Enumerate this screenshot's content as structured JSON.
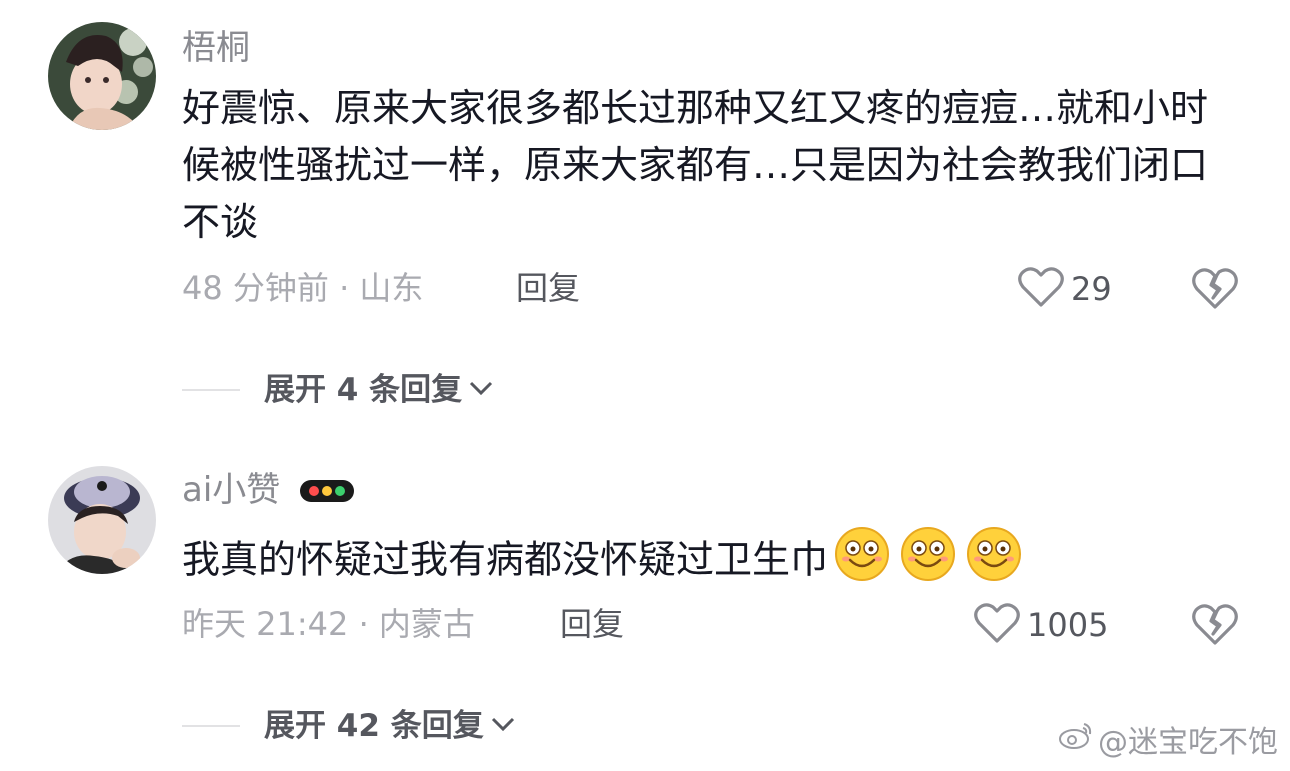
{
  "comments": [
    {
      "username": "梧桐",
      "text": "好震惊、原来大家很多都长过那种又红又疼的痘痘…就和小时候被性骚扰过一样，原来大家都有…只是因为社会教我们闭口不谈",
      "time_location": "48 分钟前 · 山东",
      "reply_label": "回复",
      "likes": "29",
      "expand_label": "展开 4 条回复"
    },
    {
      "username": "ai小赞",
      "text": "我真的怀疑过我有病都没怀疑过卫生巾",
      "emojis": [
        "smile-emoji",
        "smile-emoji",
        "smile-emoji"
      ],
      "time_location": "昨天 21:42 · 内蒙古",
      "reply_label": "回复",
      "likes": "1005",
      "expand_label": "展开 42 条回复"
    }
  ],
  "watermark": "@迷宝吃不饱",
  "colors": {
    "text": "#161823",
    "secondary": "#a9aab0",
    "action": "#55575e"
  }
}
